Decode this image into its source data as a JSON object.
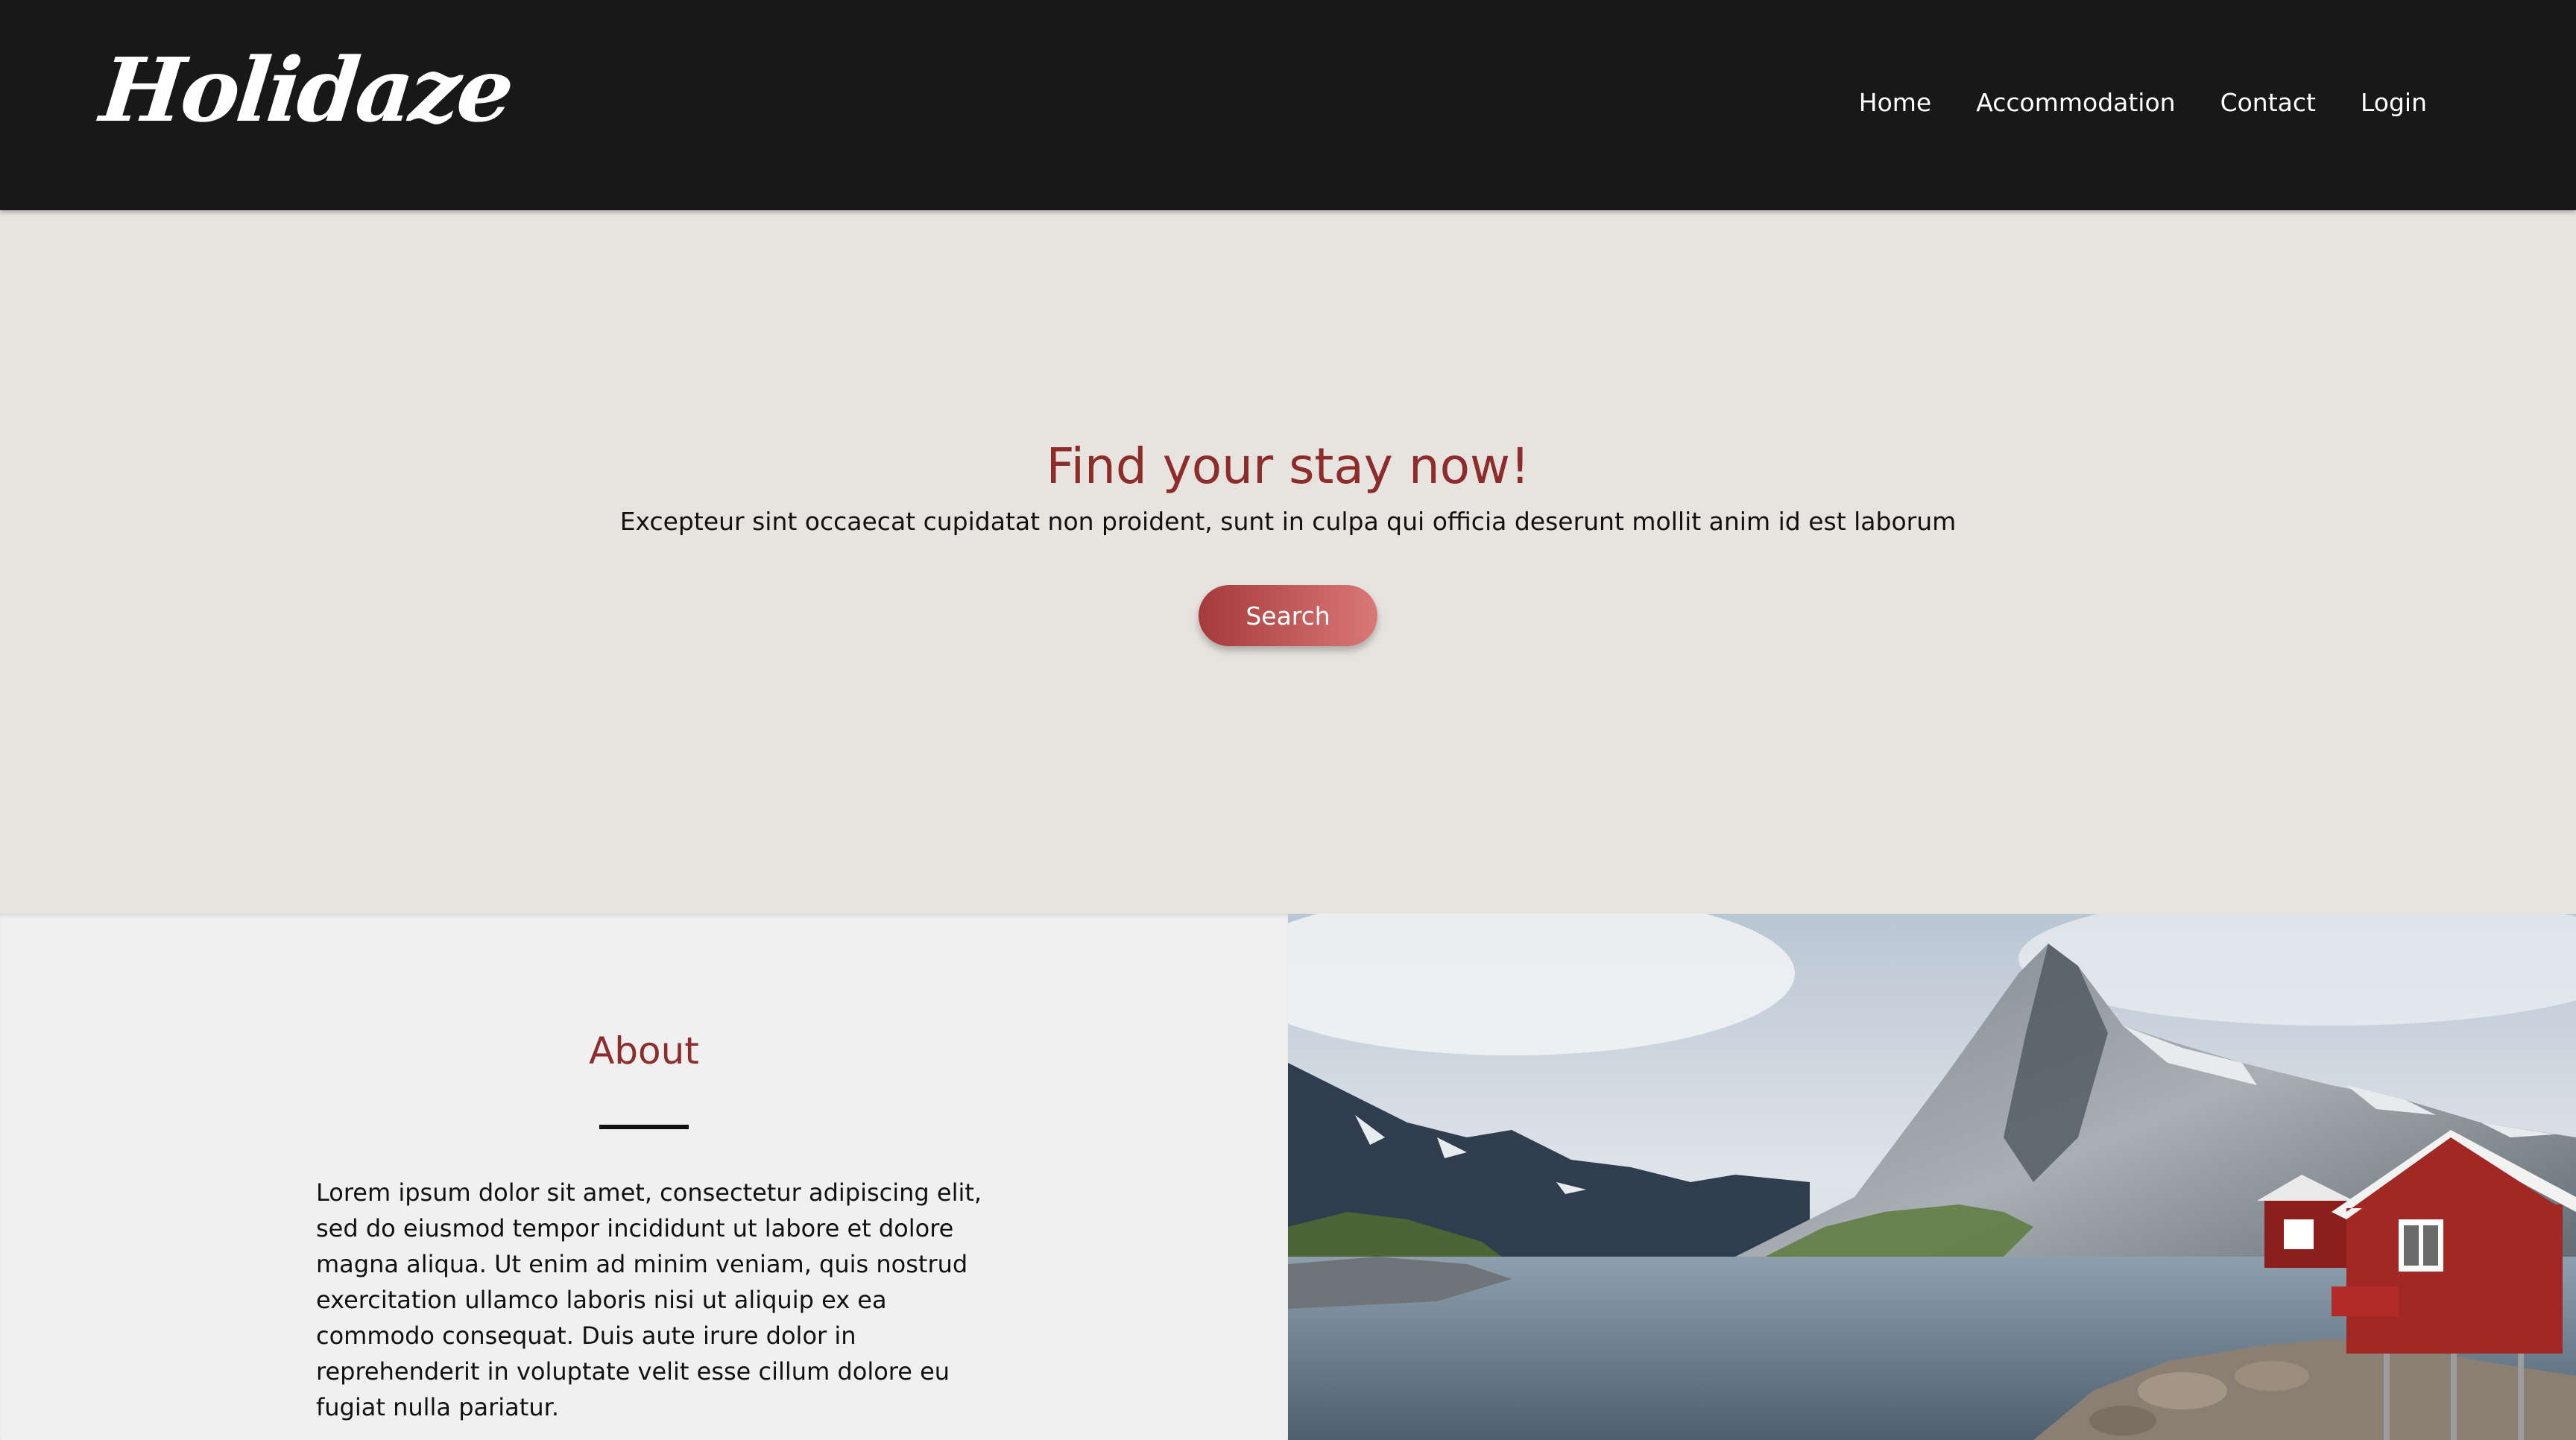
{
  "header": {
    "logo_text": "Holidaze",
    "nav": [
      {
        "label": "Home"
      },
      {
        "label": "Accommodation"
      },
      {
        "label": "Contact"
      },
      {
        "label": "Login"
      }
    ]
  },
  "hero": {
    "title": "Find your stay now!",
    "subtitle": "Excepteur sint occaecat cupidatat non proident, sunt in culpa qui officia deserunt mollit anim id est laborum",
    "search_label": "Search"
  },
  "about": {
    "title": "About",
    "body": "Lorem ipsum dolor sit amet, consectetur adipiscing elit, sed do eiusmod tempor incididunt ut labore et dolore magna aliqua. Ut enim ad minim veniam, quis nostrud exercitation ullamco laboris nisi ut aliquip ex ea commodo consequat. Duis aute irure dolor in reprehenderit in voluptate velit esse cillum dolore eu fugiat nulla pariatur."
  },
  "colors": {
    "header_bg": "#181818",
    "hero_bg": "#e7e3de",
    "accent": "#8e2b2b",
    "button_gradient_start": "#a53a3a",
    "button_gradient_end": "#d97877",
    "about_bg": "#f0f0f0"
  }
}
